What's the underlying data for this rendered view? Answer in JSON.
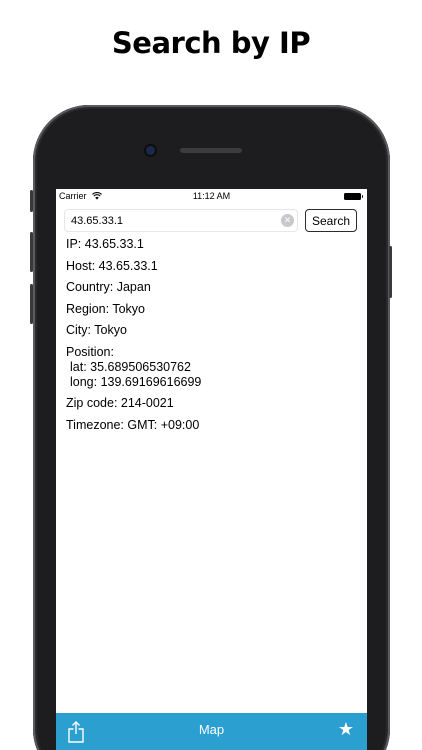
{
  "headline": "Search by IP",
  "status_bar": {
    "carrier": "Carrier",
    "time": "11:12 AM"
  },
  "search": {
    "value": "43.65.33.1",
    "button_label": "Search"
  },
  "results": {
    "ip": "IP: 43.65.33.1",
    "host": "Host: 43.65.33.1",
    "country": "Country: Japan",
    "region": "Region: Tokyo",
    "city": "City: Tokyo",
    "position_label": "Position:",
    "lat": "lat: 35.689506530762",
    "long": "long: 139.69169616699",
    "zip": "Zip code: 214-0021",
    "timezone": "Timezone: GMT: +09:00"
  },
  "tabbar": {
    "map_label": "Map",
    "star_glyph": "★",
    "share_icon": "share-icon"
  },
  "colors": {
    "tabbar": "#2a9fd0",
    "phone_frame": "#1d1d1f"
  }
}
